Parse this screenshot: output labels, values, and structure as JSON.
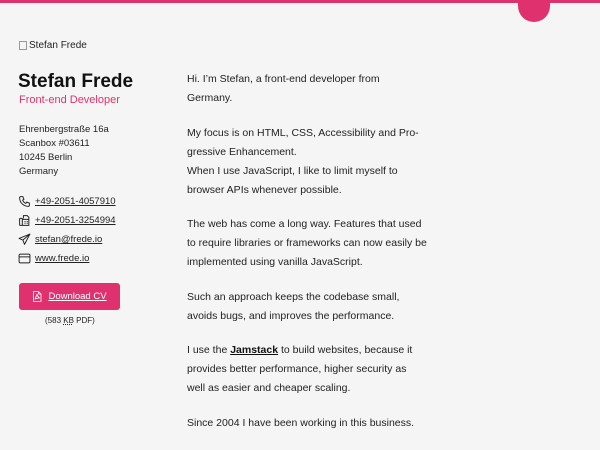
{
  "colors": {
    "accent": "#e0316f",
    "background": "#f5f5f6"
  },
  "profile": {
    "avatar_alt": "Stefan Frede",
    "name": "Stefan Frede",
    "role": "Front-end Developer"
  },
  "address": {
    "street": "Ehrenbergstraße 16a",
    "box": "Scanbox #03611",
    "city": "10245 Berlin",
    "country": "Germany"
  },
  "contacts": [
    {
      "icon": "phone-icon",
      "text": "+49-2051-4057910"
    },
    {
      "icon": "fax-icon",
      "text": "+49-2051-3254994"
    },
    {
      "icon": "paper-plane-icon",
      "text_user": "stefan",
      "text_at": "@",
      "text_domain": "frede.io"
    },
    {
      "icon": "browser-window-icon",
      "text": "www.frede.io"
    }
  ],
  "cv": {
    "button_label": "Download CV",
    "icon": "pdf-file-icon",
    "size_open": "(583 ",
    "size_unit": "KB",
    "size_close": " PDF)"
  },
  "bio": {
    "p1": "Hi. I’m Stefan, a front-end developer from Germany.",
    "p2_line1": "My focus is on HTML, CSS, Accessibility and Pro-gressive Enhancement.",
    "p2_line2": "When I use JavaScript, I like to limit myself to browser APIs whenever possible.",
    "p3": "The web has come a long way. Features that used to require libraries or frameworks can now easily be implemented using vanilla JavaScript.",
    "p4": "Such an approach keeps the codebase small, avoids bugs, and improves the performance.",
    "p5_before": "I use the ",
    "p5_link": "Jamstack",
    "p5_after": " to build websites, because it provides better performance, higher security as well as easier and cheaper scaling.",
    "p6": "Since 2004 I have been working in this business."
  }
}
